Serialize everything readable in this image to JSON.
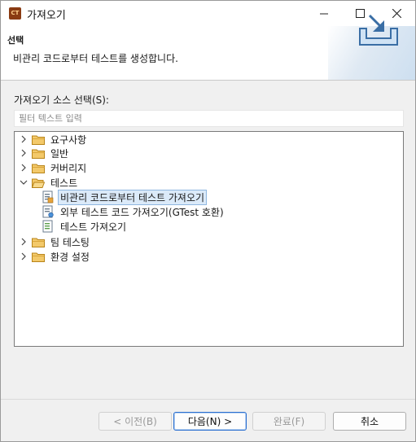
{
  "window": {
    "icon_text": "CT",
    "title": "가져오기"
  },
  "banner": {
    "title": "선택",
    "description": "비관리 코드로부터 테스트를 생성합니다."
  },
  "source": {
    "label": "가져오기 소스 선택(S):",
    "filter_placeholder": "필터 텍스트 입력"
  },
  "tree": {
    "items": [
      {
        "label": "요구사항",
        "expanded": false
      },
      {
        "label": "일반",
        "expanded": false
      },
      {
        "label": "커버리지",
        "expanded": false
      },
      {
        "label": "테스트",
        "expanded": true
      },
      {
        "label": "비관리 코드로부터 테스트 가져오기",
        "selected": true
      },
      {
        "label": "외부 테스트 코드 가져오기(GTest 호환)"
      },
      {
        "label": "테스트 가져오기"
      },
      {
        "label": "팀 테스팅",
        "expanded": false
      },
      {
        "label": "환경 설정",
        "expanded": false
      }
    ]
  },
  "buttons": {
    "back": "< 이전(B)",
    "next": "다음(N) >",
    "finish": "완료(F)",
    "cancel": "취소"
  },
  "colors": {
    "folder": "#e8b04a",
    "selection_bg": "#dbeaf9",
    "selection_border": "#8fb7e0",
    "primary_border": "#2a6fd0"
  }
}
